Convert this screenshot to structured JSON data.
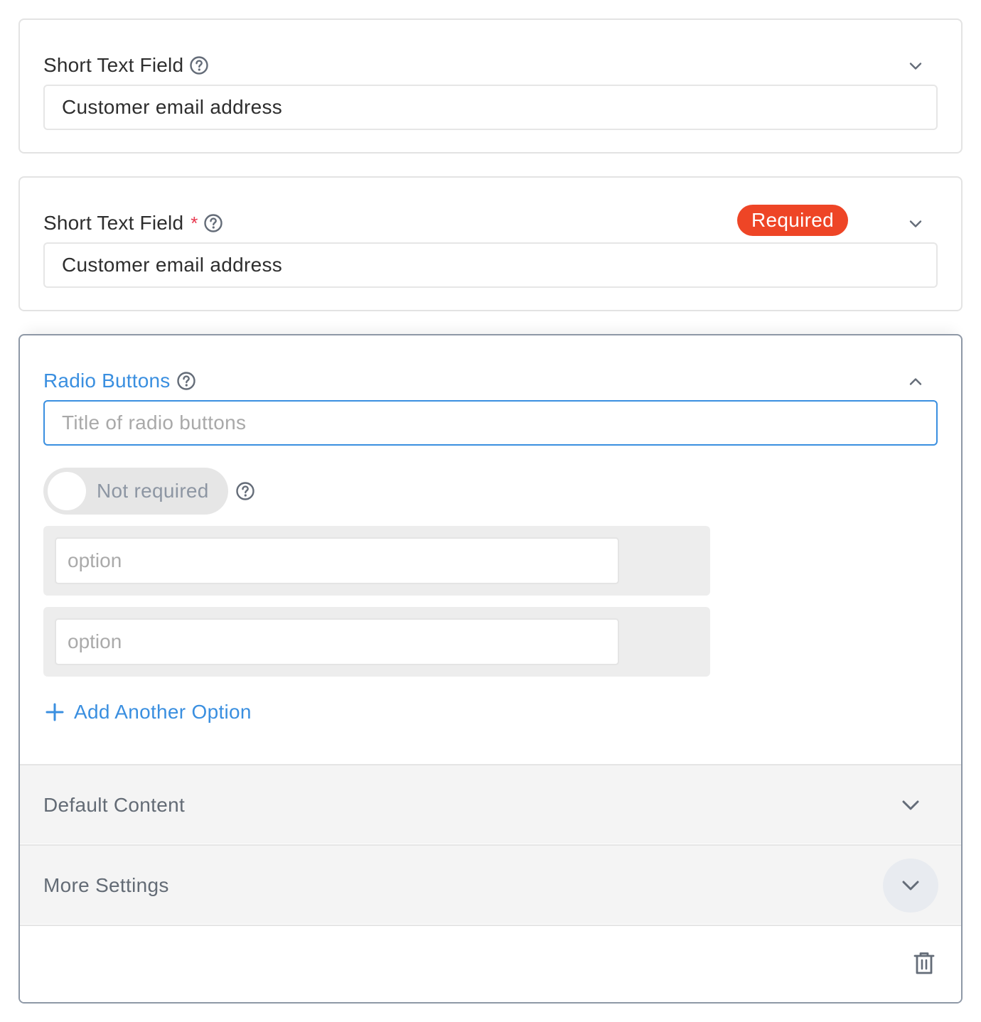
{
  "fields": [
    {
      "type_label": "Short Text Field",
      "required_marker": "",
      "help_icon": "question-circle-icon",
      "value": "Customer email address",
      "expand_icon": "chevron-down-icon"
    },
    {
      "type_label": "Short Text Field",
      "required_marker": "*",
      "help_icon": "question-circle-icon",
      "badge": "Required",
      "value": "Customer email address",
      "expand_icon": "chevron-down-icon"
    }
  ],
  "radio_field": {
    "type_label": "Radio Buttons",
    "help_icon": "question-circle-icon",
    "collapse_icon": "chevron-up-icon",
    "title_input": {
      "value": "",
      "placeholder": "Title of radio buttons"
    },
    "required_toggle": {
      "label": "Not required",
      "on": false
    },
    "options": [
      {
        "value": "",
        "placeholder": "option"
      },
      {
        "value": "",
        "placeholder": "option"
      }
    ],
    "add_option_label": "Add Another Option",
    "add_option_icon": "plus-icon",
    "sections": [
      {
        "label": "Default Content",
        "icon": "chevron-down-icon"
      },
      {
        "label": "More Settings",
        "icon": "chevron-down-icon"
      }
    ],
    "delete_icon": "trash-icon"
  },
  "colors": {
    "accent": "#3a8fe0",
    "required_badge": "#ee4526",
    "asterisk": "#e8384f",
    "icon": "#646c78",
    "muted_text": "#636b75",
    "active_card_border": "#8e98a6"
  }
}
